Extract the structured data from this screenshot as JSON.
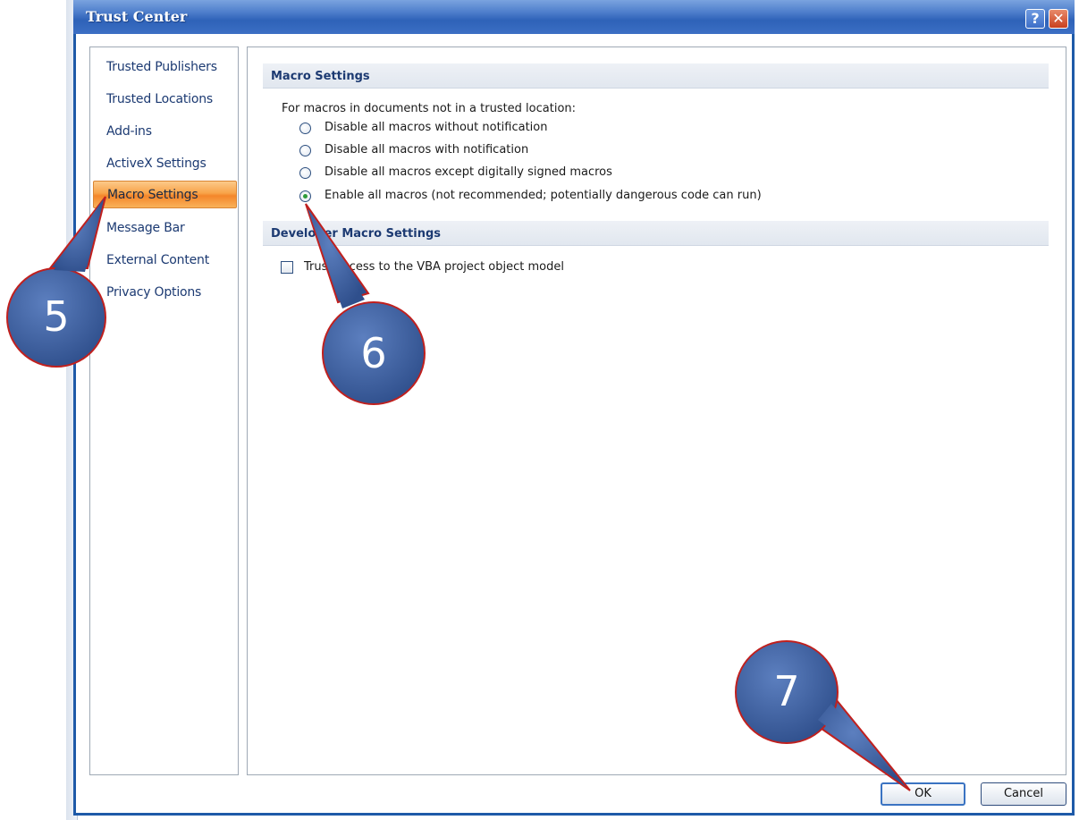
{
  "window": {
    "title": "Trust Center",
    "help_glyph": "?",
    "close_glyph": "✕"
  },
  "nav": {
    "items": [
      {
        "label": "Trusted Publishers"
      },
      {
        "label": "Trusted Locations"
      },
      {
        "label": "Add-ins"
      },
      {
        "label": "ActiveX Settings"
      },
      {
        "label": "Macro Settings",
        "selected": true
      },
      {
        "label": "Message Bar"
      },
      {
        "label": "External Content"
      },
      {
        "label": "Privacy Options"
      }
    ]
  },
  "macro_settings": {
    "heading": "Macro Settings",
    "lead": "For macros in documents not in a trusted location:",
    "options": [
      {
        "label": "Disable all macros without notification",
        "checked": false
      },
      {
        "label": "Disable all macros with notification",
        "checked": false
      },
      {
        "label": "Disable all macros except digitally signed macros",
        "checked": false
      },
      {
        "label": "Enable all macros (not recommended; potentially dangerous code can run)",
        "checked": true
      }
    ]
  },
  "developer_settings": {
    "heading": "Developer Macro Settings",
    "trust_vba_label": "Trust access to the VBA project object model",
    "trust_vba_checked": false
  },
  "buttons": {
    "ok": "OK",
    "cancel": "Cancel"
  },
  "annotations": {
    "step5": "5",
    "step6": "6",
    "step7": "7",
    "callout_fill": "#3d5f9e",
    "callout_border": "#c0201e"
  }
}
